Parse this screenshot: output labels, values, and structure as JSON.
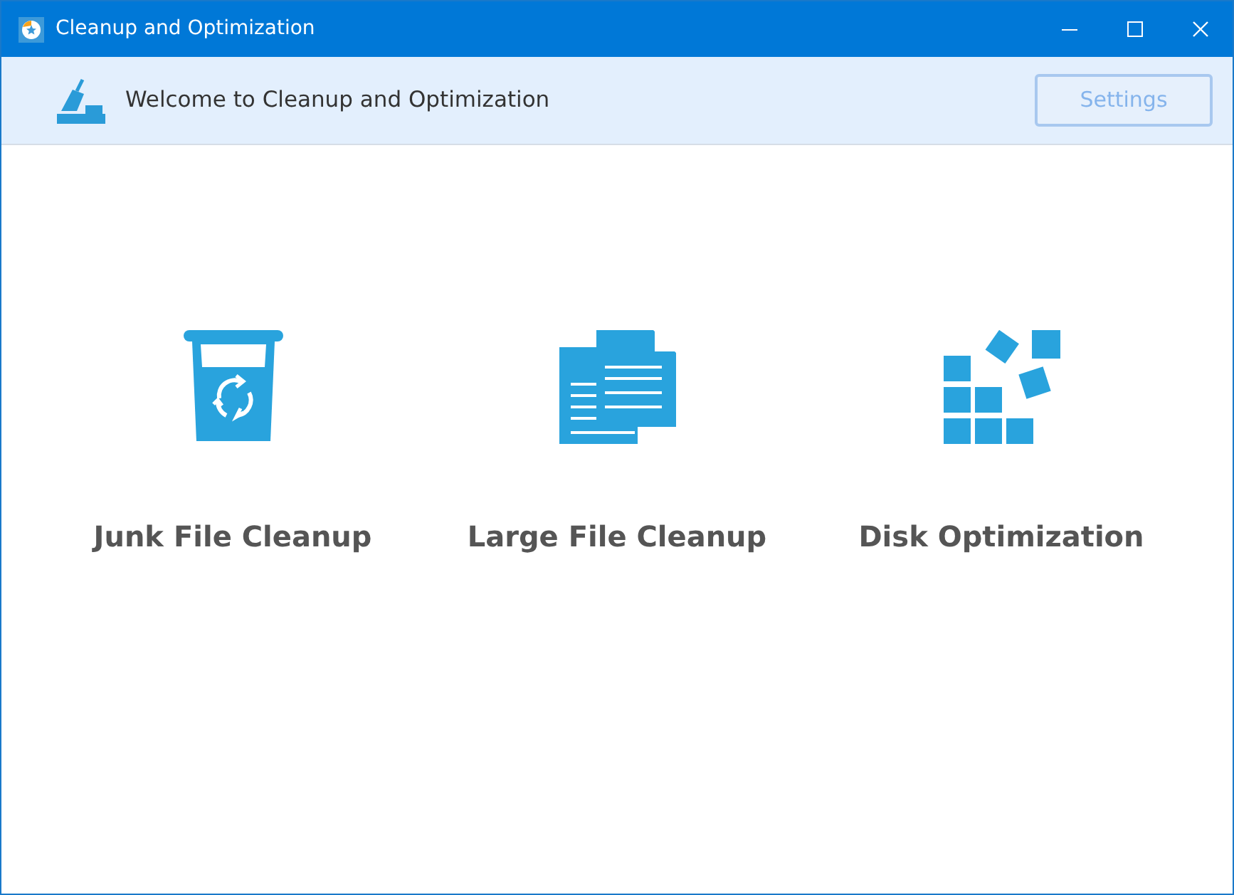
{
  "window": {
    "title": "Cleanup and Optimization"
  },
  "header": {
    "welcome": "Welcome to Cleanup and Optimization",
    "settings": {
      "label": "Settings",
      "disabled": true
    }
  },
  "tools": [
    {
      "kind": "junk",
      "label": "Junk File Cleanup"
    },
    {
      "kind": "large",
      "label": "Large File Cleanup"
    },
    {
      "kind": "disk",
      "label": "Disk Optimization"
    }
  ]
}
